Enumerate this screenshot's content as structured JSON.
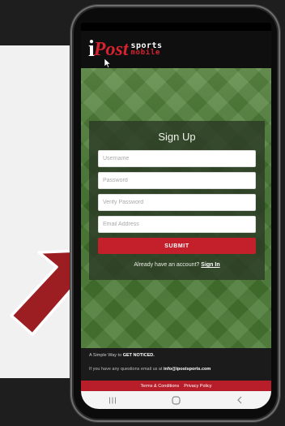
{
  "brand": {
    "letter_i": "i",
    "post": "Post",
    "sports": "sports",
    "mobile": "mobile"
  },
  "signup": {
    "title": "Sign Up",
    "username_placeholder": "Username",
    "password_placeholder": "Password",
    "verify_placeholder": "Verify Password",
    "email_placeholder": "Email Address",
    "submit_label": "SUBMIT",
    "account_prompt": "Already have an account?",
    "signin_label": "Sign In"
  },
  "footer": {
    "tagline_prefix": "A Simple Way to",
    "tagline_bold": "GET NOTICED.",
    "contact_prefix": "If you have any questions email us at",
    "contact_email": "info@ipostsports.com",
    "terms_label": "Terms & Conditions",
    "privacy_label": "Privacy Policy"
  },
  "navbar": {
    "recents_icon": "recents-icon",
    "home_icon": "home-icon",
    "back_icon": "back-icon"
  },
  "colors": {
    "accent_red": "#c4202c",
    "arrow_red": "#9c1e22",
    "field_green": "#4a7a33",
    "card_overlay": "#2c3a26",
    "header_black": "#0f0f0f"
  }
}
